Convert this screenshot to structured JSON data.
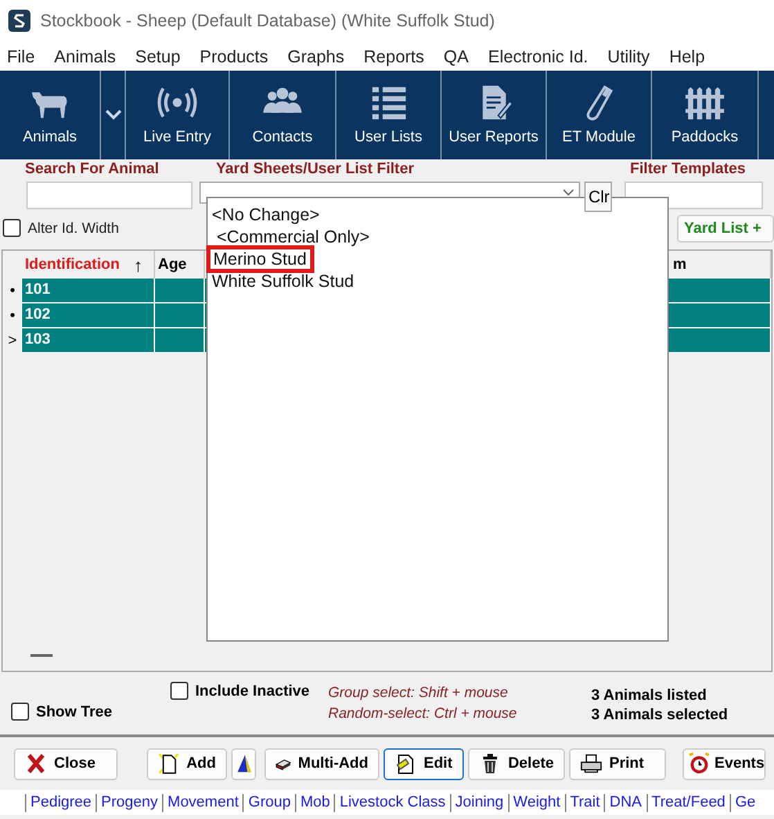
{
  "window": {
    "title": "Stockbook - Sheep (Default Database) (White Suffolk Stud)"
  },
  "menu": [
    "File",
    "Animals",
    "Setup",
    "Products",
    "Graphs",
    "Reports",
    "QA",
    "Electronic Id.",
    "Utility",
    "Help"
  ],
  "toolbar": [
    {
      "kind": "cow",
      "label": "Animals"
    },
    {
      "kind": "chevron"
    },
    {
      "kind": "signal",
      "label": "Live Entry"
    },
    {
      "kind": "people",
      "label": "Contacts"
    },
    {
      "kind": "list",
      "label": "User Lists"
    },
    {
      "kind": "report",
      "label": "User Reports"
    },
    {
      "kind": "tube",
      "label": "ET Module"
    },
    {
      "kind": "fence",
      "label": "Paddocks"
    }
  ],
  "filters": {
    "search_label": "Search For Animal",
    "yard_label": "Yard Sheets/User List Filter",
    "clear_button": "Clr",
    "templates_label": "Filter Templates",
    "alter_width": {
      "label": "Alter Id. Width",
      "checked": false
    },
    "yard_list_button": "Yard List +"
  },
  "dropdown": [
    {
      "label": "<No Change>",
      "highlighted": false
    },
    {
      "label": " <Commercial Only>",
      "highlighted": false
    },
    {
      "label": "Merino Stud",
      "highlighted": true
    },
    {
      "label": "White Suffolk Stud",
      "highlighted": false
    }
  ],
  "table": {
    "columns": [
      "Identification",
      "Age",
      "m"
    ],
    "sort_arrow": "↑",
    "rows": [
      {
        "marker": "•",
        "id": "101",
        "selected": true
      },
      {
        "marker": "•",
        "id": "102",
        "selected": true
      },
      {
        "marker": ">",
        "id": "103",
        "selected": true
      }
    ]
  },
  "options": {
    "include_inactive": {
      "label": "Include Inactive",
      "checked": false
    },
    "show_tree": {
      "label": "Show Tree",
      "checked": false
    },
    "hints": [
      "Group select: Shift + mouse",
      "Random-select: Ctrl + mouse"
    ],
    "status": [
      "3 Animals listed",
      "3 Animals selected"
    ]
  },
  "buttons": [
    {
      "kind": "close",
      "label": "Close",
      "focused": false
    },
    {
      "kind": "add",
      "label": "Add",
      "focused": false
    },
    {
      "kind": "wizard",
      "focused": false
    },
    {
      "kind": "multi",
      "label": "Multi-Add",
      "focused": false
    },
    {
      "kind": "edit",
      "label": "Edit",
      "focused": true
    },
    {
      "kind": "delete",
      "label": "Delete",
      "focused": false
    },
    {
      "kind": "print",
      "label": "Print",
      "focused": false
    },
    {
      "kind": "events",
      "label": "Events",
      "focused": false
    }
  ],
  "tabs": [
    "Pedigree",
    "Progeny",
    "Movement",
    "Group",
    "Mob",
    "Livestock Class",
    "Joining",
    "Weight",
    "Trait",
    "DNA",
    "Treat/Feed",
    "Ge"
  ]
}
